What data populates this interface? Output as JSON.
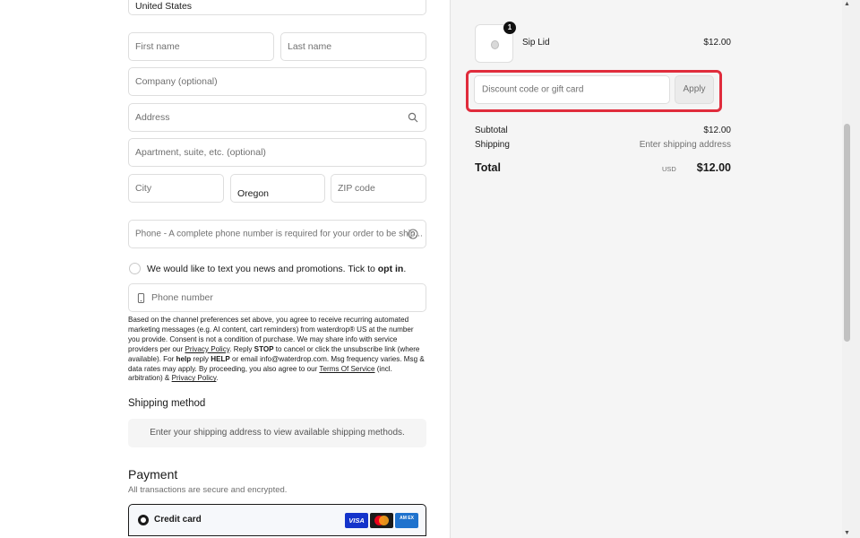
{
  "shipping_form": {
    "country_value": "United States",
    "first_name_placeholder": "First name",
    "last_name_placeholder": "Last name",
    "company_placeholder": "Company (optional)",
    "address_placeholder": "Address",
    "apartment_placeholder": "Apartment, suite, etc. (optional)",
    "city_placeholder": "City",
    "state_value": "Oregon",
    "zip_placeholder": "ZIP code",
    "phone_placeholder": "Phone - A complete phone number is required for your order to be ship..."
  },
  "sms_optin": {
    "text_before": "We would like to text you news and promotions. Tick to ",
    "text_bold": "opt in",
    "text_after": ".",
    "phone_placeholder": "Phone number"
  },
  "legal": {
    "p1": "Based on the channel preferences set above, you agree to receive recurring automated marketing messages (e.g. AI content, cart reminders) from waterdrop® US at the number you provide. Consent is not a condition of purchase. We may share info with service providers per our ",
    "privacy_link_1": "Privacy Policy",
    "p2": ". Reply ",
    "stop": "STOP",
    "p3": " to cancel or click the unsubscribe link (where available). For ",
    "help": "help",
    "p4": " reply ",
    "help2": "HELP",
    "p5": " or email info@waterdrop.com. Msg frequency varies. Msg & data rates may apply. By proceeding, you also agree to our ",
    "tos_link": "Terms Of Service",
    "p6": " (incl. arbitration) & ",
    "privacy_link_2": "Privacy Policy",
    "p7": "."
  },
  "shipping_method": {
    "title": "Shipping method",
    "message": "Enter your shipping address to view available shipping methods."
  },
  "payment": {
    "title": "Payment",
    "subtitle": "All transactions are secure and encrypted.",
    "option_label": "Credit card",
    "cards": {
      "visa": "VISA",
      "amex": "AM EX"
    }
  },
  "order_summary": {
    "item": {
      "quantity": "1",
      "name": "Sip Lid",
      "price": "$12.00"
    },
    "discount_placeholder": "Discount code or gift card",
    "apply_label": "Apply",
    "subtotal_label": "Subtotal",
    "subtotal_value": "$12.00",
    "shipping_label": "Shipping",
    "shipping_value": "Enter shipping address",
    "total_label": "Total",
    "currency": "USD",
    "total_value": "$12.00"
  },
  "colors": {
    "highlight": "#e02c3c",
    "summary_bg": "#f5f5f5",
    "border": "#dedede"
  }
}
